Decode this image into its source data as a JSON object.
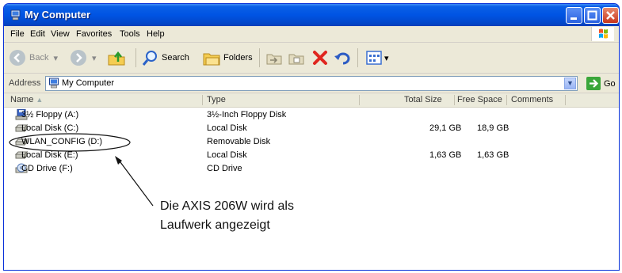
{
  "window": {
    "title": "My Computer"
  },
  "menu": {
    "file": "File",
    "edit": "Edit",
    "view": "View",
    "favorites": "Favorites",
    "tools": "Tools",
    "help": "Help"
  },
  "toolbar": {
    "back": "Back",
    "search": "Search",
    "folders": "Folders"
  },
  "address": {
    "label": "Address",
    "value": "My Computer",
    "go": "Go"
  },
  "columns": {
    "name": "Name",
    "type": "Type",
    "total_size": "Total Size",
    "free_space": "Free Space",
    "comments": "Comments"
  },
  "rows": [
    {
      "name": "3½ Floppy (A:)",
      "type": "3½-Inch Floppy Disk",
      "total": "",
      "free": "",
      "icon": "floppy-drive-icon"
    },
    {
      "name": "Local Disk (C:)",
      "type": "Local Disk",
      "total": "29,1 GB",
      "free": "18,9 GB",
      "icon": "hard-disk-icon"
    },
    {
      "name": "WLAN_CONFIG (D:)",
      "type": "Removable Disk",
      "total": "",
      "free": "",
      "icon": "removable-disk-icon"
    },
    {
      "name": "Local Disk (E:)",
      "type": "Local Disk",
      "total": "1,63 GB",
      "free": "1,63 GB",
      "icon": "hard-disk-icon"
    },
    {
      "name": "CD Drive (F:)",
      "type": "CD Drive",
      "total": "",
      "free": "",
      "icon": "cd-drive-icon"
    }
  ],
  "annotation": {
    "line1": "Die AXIS 206W wird als",
    "line2": "Laufwerk angezeigt"
  },
  "colors": {
    "titlebar": "#0054e3",
    "close": "#c8361d",
    "header_bg": "#ebeadb"
  }
}
